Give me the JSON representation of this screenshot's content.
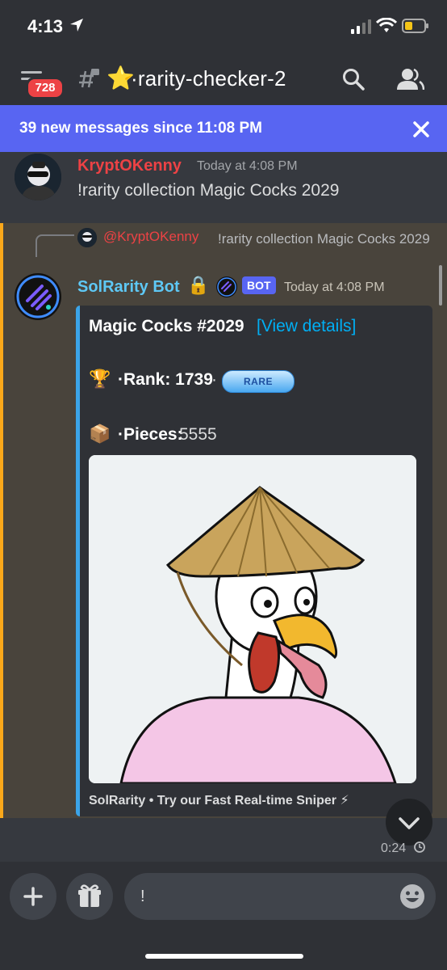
{
  "status_bar": {
    "time": "4:13"
  },
  "header": {
    "badge_count": "728",
    "channel_star": "⭐",
    "channel_name": "·rarity-checker-2"
  },
  "new_messages_bar": {
    "text": "39 new messages since 11:08 PM"
  },
  "messages": [
    {
      "author": "KryptOKenny",
      "author_color": "#ed4245",
      "timestamp": "Today at 4:08 PM",
      "content": "!rarity collection Magic Cocks 2029"
    },
    {
      "reply": {
        "author": "@KryptOKenny",
        "text": "!rarity collection Magic Cocks 2029"
      },
      "author": "SolRarity Bot",
      "author_color": "#5ec8f5",
      "lock_emoji": "🔒",
      "bot_tag": "BOT",
      "timestamp": "Today at 4:08 PM",
      "embed": {
        "title": "Magic Cocks #2029",
        "link": "[View details]",
        "rank_emoji": "🏆",
        "rank_label": "·Rank: 1739",
        "rank_sep": "·",
        "rarity_badge": "RARE",
        "pieces_emoji": "📦",
        "pieces_label": "·Pieces:",
        "pieces_value": "5555",
        "footer": "SolRarity • Try our Fast Real-time Sniper ⚡",
        "accent_color": "#3ba4e8"
      }
    }
  ],
  "video_duration": "0:24",
  "composer": {
    "input_value": "!"
  }
}
